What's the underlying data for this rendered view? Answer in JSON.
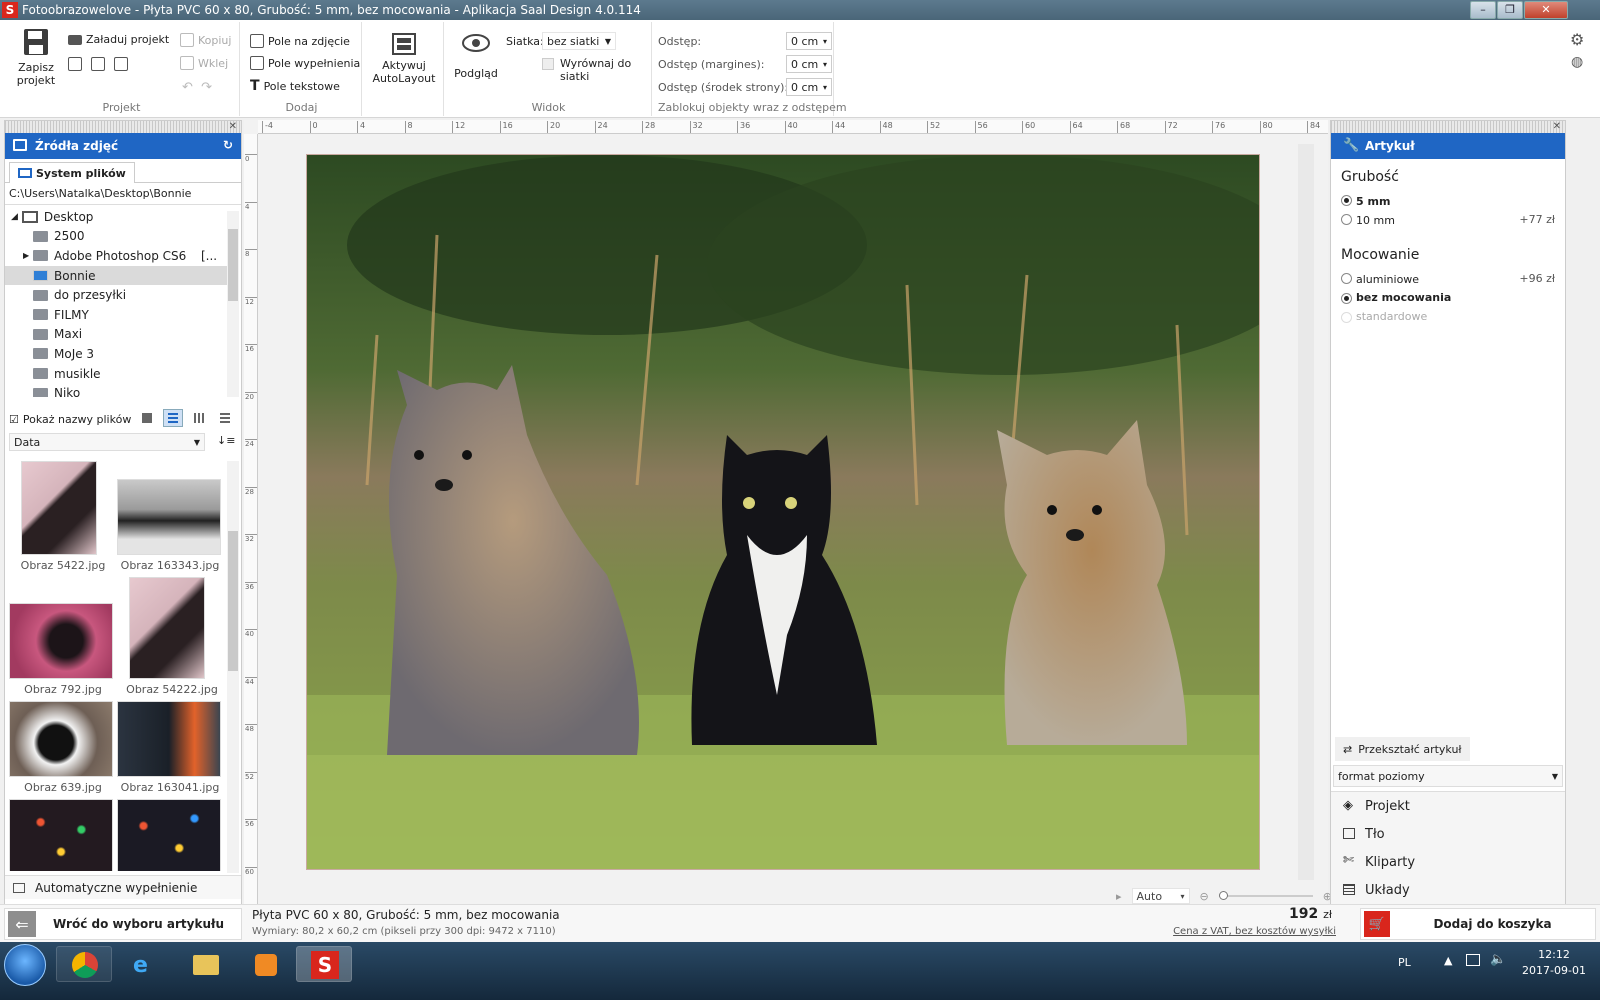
{
  "window": {
    "title": "Fotoobrazowelove - Płyta PVC 60 x 80, Grubość: 5 mm, bez mocowania - Aplikacja Saal Design 4.0.114",
    "logo_letter": "S"
  },
  "ribbon": {
    "projekt": {
      "save_label_1": "Zapisz",
      "save_label_2": "projekt",
      "load_label": "Załaduj projekt",
      "copy_label": "Kopiuj",
      "paste_label": "Wklej",
      "group_title": "Projekt"
    },
    "dodaj": {
      "photo_field": "Pole na zdjęcie",
      "fill_field": "Pole wypełnienia",
      "text_field": "Pole tekstowe",
      "group_title": "Dodaj"
    },
    "autolayout": {
      "label_1": "Aktywuj",
      "label_2": "AutoLayout"
    },
    "widok": {
      "preview_label": "Podgląd",
      "grid_label": "Siatka:",
      "grid_value": "bez siatki",
      "align_label": "Wyrównaj do siatki",
      "group_title": "Widok"
    },
    "spacing": {
      "odstep_label": "Odstęp:",
      "odstep_value": "0 cm",
      "margins_label": "Odstęp (margines):",
      "margins_value": "0 cm",
      "center_label": "Odstęp (środek strony):",
      "center_value": "0 cm",
      "group_title": "Zablokuj objekty wraz z odstępem"
    }
  },
  "left_panel": {
    "title": "Źródła zdjęć",
    "tab": "System plików",
    "path": "C:\\Users\\Natalka\\Desktop\\Bonnie",
    "tree": [
      {
        "label": "Desktop"
      },
      {
        "label": "2500"
      },
      {
        "label": "Adobe Photoshop CS6"
      },
      {
        "label": "Bonnie"
      },
      {
        "label": "do przesyłki"
      },
      {
        "label": "FILMY"
      },
      {
        "label": "Maxi"
      },
      {
        "label": "MoJe 3"
      },
      {
        "label": "musikle"
      },
      {
        "label": "Niko"
      }
    ],
    "tree_more": "[...",
    "show_names_label": "Pokaż nazwy plików",
    "sort_value": "Data",
    "thumbs": [
      {
        "caption": "Obraz 5422.jpg"
      },
      {
        "caption": "Obraz 163343.jpg"
      },
      {
        "caption": "Obraz 792.jpg"
      },
      {
        "caption": "Obraz 54222.jpg"
      },
      {
        "caption": "Obraz 639.jpg"
      },
      {
        "caption": "Obraz 163041.jpg"
      }
    ],
    "auto_fill_label": "Automatyczne wypełnienie",
    "back_label": "Wróć do wyboru artykułu"
  },
  "ruler": {
    "top_ticks": [
      "-4",
      "0",
      "4",
      "8",
      "12",
      "16",
      "20",
      "24",
      "28",
      "32",
      "36",
      "40",
      "44",
      "48",
      "52",
      "56",
      "60",
      "64",
      "68",
      "72",
      "76",
      "80",
      "84"
    ],
    "left_ticks": [
      "0",
      "4",
      "8",
      "12",
      "16",
      "20",
      "24",
      "28",
      "32",
      "36",
      "40",
      "44",
      "48",
      "52",
      "56",
      "60"
    ]
  },
  "zoom": {
    "value": "Auto"
  },
  "right_panel": {
    "title": "Artykuł",
    "thickness_title": "Grubość",
    "thickness_options": [
      {
        "label": "5 mm",
        "price": ""
      },
      {
        "label": "10 mm",
        "price": "+77 zł"
      }
    ],
    "mount_title": "Mocowanie",
    "mount_options": [
      {
        "label": "aluminiowe",
        "price": "+96 zł"
      },
      {
        "label": "bez mocowania",
        "price": ""
      },
      {
        "label": "standardowe",
        "price": ""
      }
    ],
    "transform_label": "Przekształć artykuł",
    "format_value": "format poziomy",
    "nav": [
      {
        "label": "Projekt"
      },
      {
        "label": "Tło"
      },
      {
        "label": "Kliparty"
      },
      {
        "label": "Układy"
      }
    ],
    "cart_label": "Dodaj do koszyka"
  },
  "status": {
    "product": "Płyta PVC 60 x 80, Grubość: 5 mm, bez mocowania",
    "dimensions": "Wymiary: 80,2 x 60,2 cm (pikseli przy 300 dpi: 9472 x 7110)",
    "price": "192",
    "currency": "zł",
    "price_note": "Cena z VAT, bez kosztów wysyłki"
  },
  "taskbar": {
    "lang": "PL",
    "time": "12:12",
    "date": "2017-09-01"
  }
}
